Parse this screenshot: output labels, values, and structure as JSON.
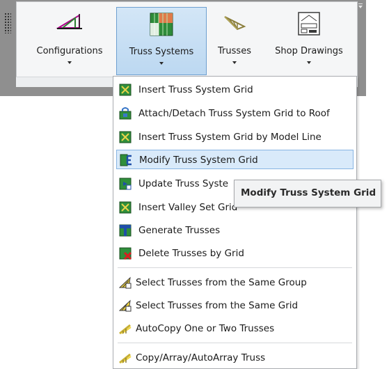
{
  "ribbon": {
    "buttons": [
      {
        "label": "Configurations",
        "icon": "roof-configuration-icon"
      },
      {
        "label": "Truss Systems",
        "icon": "truss-system-grid-icon",
        "active": true
      },
      {
        "label": "Trusses",
        "icon": "truss-icon"
      },
      {
        "label": "Shop Drawings",
        "icon": "shop-drawing-sheet-icon"
      }
    ]
  },
  "menu": {
    "items": [
      {
        "label": "Insert Truss System Grid",
        "icon": "insert-grid-icon"
      },
      {
        "label": "Attach/Detach Truss System Grid to Roof",
        "icon": "attach-grid-icon"
      },
      {
        "label": "Insert Truss System Grid by Model Line",
        "icon": "insert-grid-model-line-icon"
      },
      {
        "label": "Modify Truss System Grid",
        "icon": "modify-grid-icon",
        "highlighted": true
      },
      {
        "label": "Update Truss Syste",
        "icon": "update-grid-icon"
      },
      {
        "label": "Insert Valley Set Grid",
        "icon": "valley-set-grid-icon"
      },
      {
        "label": "Generate Trusses",
        "icon": "generate-trusses-icon"
      },
      {
        "label": "Delete Trusses by Grid",
        "icon": "delete-trusses-icon"
      },
      {
        "label": "Select Trusses from the Same Group",
        "icon": "select-group-icon"
      },
      {
        "label": "Select Trusses from the Same Grid",
        "icon": "select-grid-icon"
      },
      {
        "label": "AutoCopy One or Two Trusses",
        "icon": "autocopy-icon"
      },
      {
        "label": "Copy/Array/AutoArray Truss",
        "icon": "copy-array-icon"
      }
    ]
  },
  "tooltip": {
    "text": "Modify Truss System Grid"
  },
  "colors": {
    "accent": "#6d9fd0",
    "highlight": "#d9eafa",
    "frame": "#8f8f8f"
  }
}
